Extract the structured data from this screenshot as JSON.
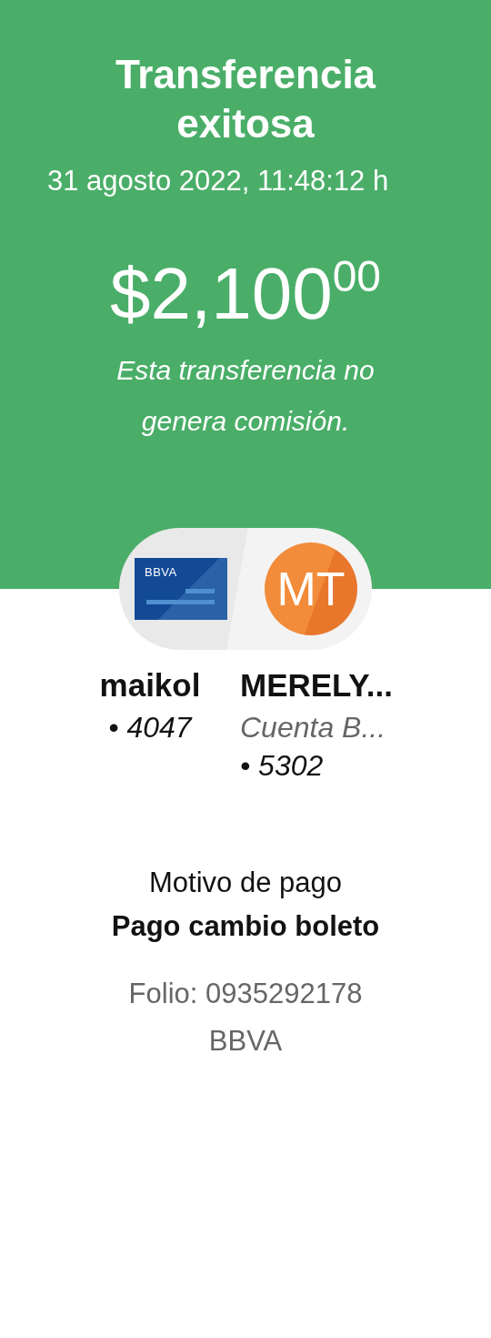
{
  "header": {
    "title": "Transferencia exitosa",
    "datetime": "31 agosto 2022, 11:48:12 h",
    "amount": "$2,100$^{00}$",
    "note": "Esta transferencia no genera comisión."
  },
  "origin": {
    "card_brand": "BBVA",
    "name": "maikol",
    "account": "• 4047"
  },
  "destination": {
    "initials": "MT",
    "name": "MERELY...",
    "account_type": "Cuenta B...",
    "account": "• 5302"
  },
  "details": {
    "label": "Motivo de pago",
    "concept": "Pago cambio boleto",
    "folio": "Folio: 0935292178",
    "bank": "BBVA"
  }
}
